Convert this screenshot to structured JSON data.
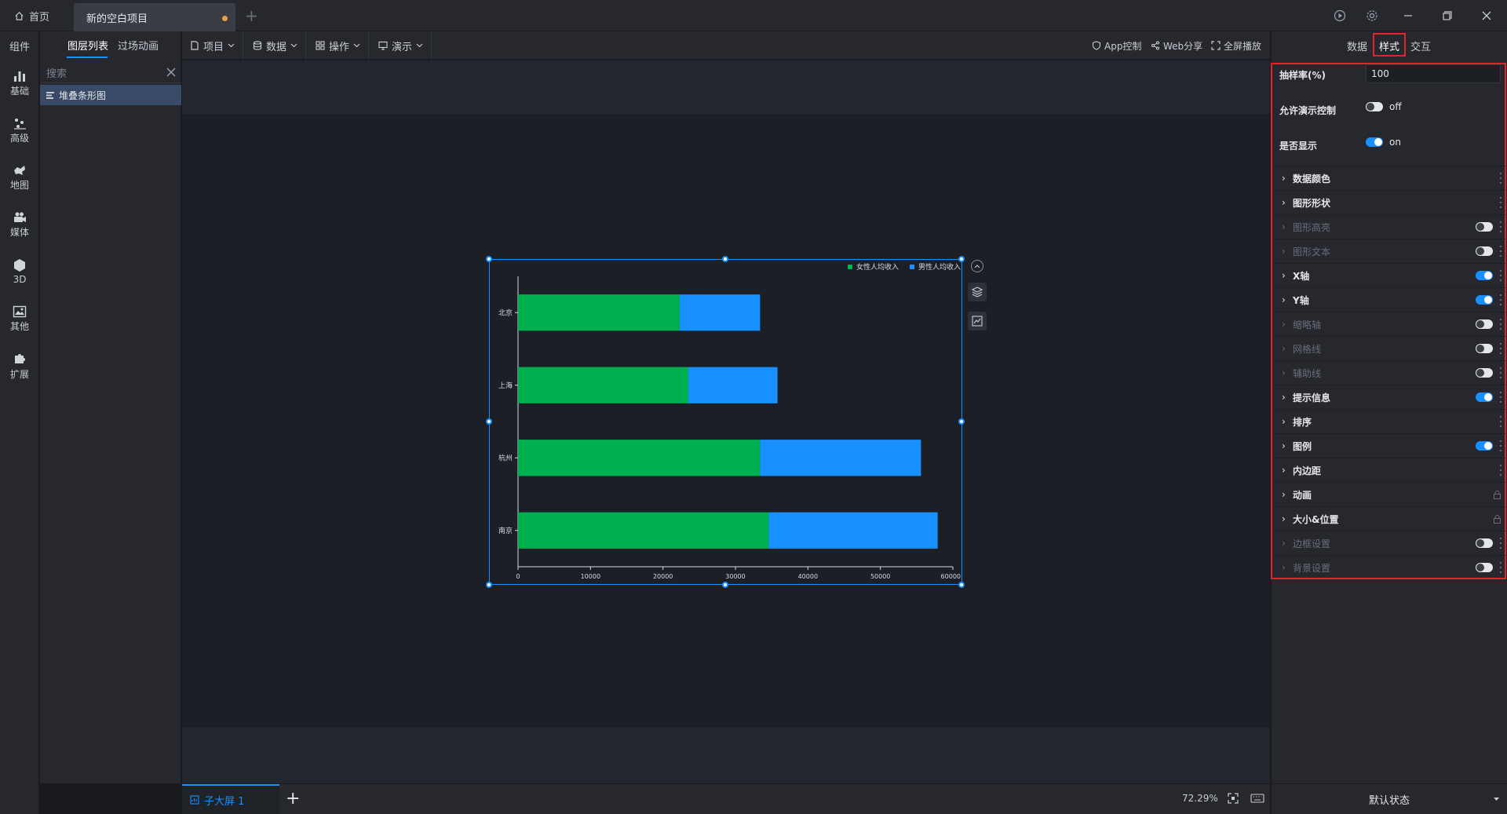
{
  "titlebar": {
    "home_label": "首页",
    "project_tab": "新的空白项目"
  },
  "iconbar": {
    "title": "组件",
    "items": [
      {
        "label": "基础",
        "icon": "bar-chart-icon"
      },
      {
        "label": "高级",
        "icon": "scatter-icon"
      },
      {
        "label": "地图",
        "icon": "map-icon"
      },
      {
        "label": "媒体",
        "icon": "camera-icon"
      },
      {
        "label": "3D",
        "icon": "cube-icon"
      },
      {
        "label": "其他",
        "icon": "image-icon"
      },
      {
        "label": "扩展",
        "icon": "puzzle-icon"
      }
    ]
  },
  "layerpanel": {
    "tab_layers": "图层列表",
    "tab_transition": "过场动画",
    "search_placeholder": "搜索",
    "layer_name": "堆叠条形图"
  },
  "toolbar": {
    "menu_project": "项目",
    "menu_data": "数据",
    "menu_operation": "操作",
    "menu_demo": "演示",
    "app_control": "App控制",
    "web_share": "Web分享",
    "fullscreen": "全屏播放"
  },
  "bottombar": {
    "screen_tab": "子大屏 1",
    "zoom": "72.29%"
  },
  "rightpanel": {
    "tab_data": "数据",
    "tab_style": "样式",
    "tab_interaction": "交互",
    "sample_rate_label": "抽样率(%)",
    "sample_rate_value": "100",
    "allow_demo_label": "允许演示控制",
    "allow_demo_state": "off",
    "show_label": "是否显示",
    "show_state": "on",
    "sections": [
      {
        "label": "数据颜色",
        "enabled": true,
        "ctrl": "none"
      },
      {
        "label": "图形形状",
        "enabled": true,
        "ctrl": "none"
      },
      {
        "label": "图形高亮",
        "enabled": false,
        "ctrl": "off"
      },
      {
        "label": "图形文本",
        "enabled": false,
        "ctrl": "off"
      },
      {
        "label": "X轴",
        "enabled": true,
        "ctrl": "on"
      },
      {
        "label": "Y轴",
        "enabled": true,
        "ctrl": "on"
      },
      {
        "label": "缩略轴",
        "enabled": false,
        "ctrl": "off"
      },
      {
        "label": "网格线",
        "enabled": false,
        "ctrl": "off"
      },
      {
        "label": "辅助线",
        "enabled": false,
        "ctrl": "off"
      },
      {
        "label": "提示信息",
        "enabled": true,
        "ctrl": "on"
      },
      {
        "label": "排序",
        "enabled": true,
        "ctrl": "none"
      },
      {
        "label": "图例",
        "enabled": true,
        "ctrl": "on"
      },
      {
        "label": "内边距",
        "enabled": true,
        "ctrl": "none"
      },
      {
        "label": "动画",
        "enabled": true,
        "ctrl": "lock"
      },
      {
        "label": "大小&位置",
        "enabled": true,
        "ctrl": "lock"
      },
      {
        "label": "边框设置",
        "enabled": false,
        "ctrl": "off"
      },
      {
        "label": "背景设置",
        "enabled": false,
        "ctrl": "off"
      }
    ],
    "footer_state": "默认状态"
  },
  "colors": {
    "accent": "#1890ff",
    "female_series": "#00b050",
    "male_series": "#1890ff",
    "highlight_border": "#e0262d"
  },
  "chart_data": {
    "type": "bar",
    "orientation": "horizontal",
    "stacked": true,
    "categories": [
      "北京",
      "上海",
      "杭州",
      "南京"
    ],
    "series": [
      {
        "name": "女性人均收入",
        "values": [
          22300,
          23500,
          33400,
          34600
        ]
      },
      {
        "name": "男性人均收入",
        "values": [
          11100,
          12300,
          22200,
          23300
        ]
      }
    ],
    "xticks": [
      0,
      10000,
      20000,
      30000,
      40000,
      50000,
      60000
    ],
    "xlim": [
      0,
      60000
    ],
    "legend_position": "top-right",
    "grid": false
  }
}
